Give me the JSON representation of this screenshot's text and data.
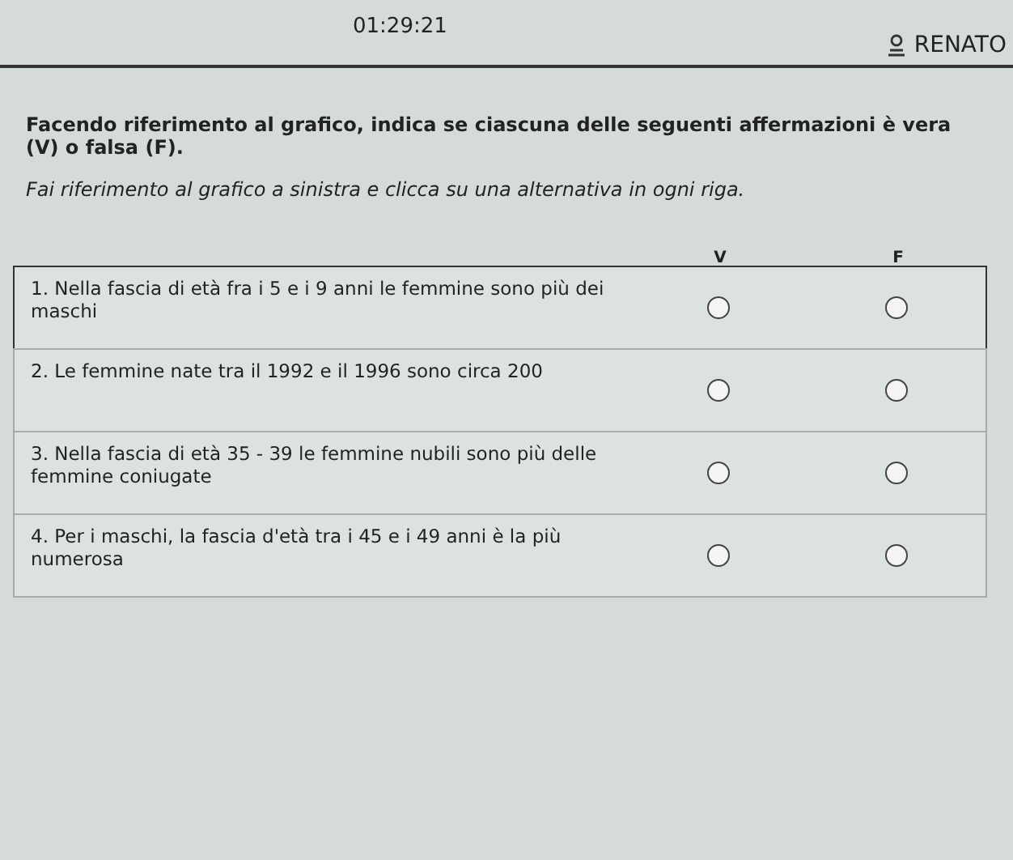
{
  "header": {
    "timer": "01:29:21",
    "user": "RENATO"
  },
  "instructions": {
    "title": "Facendo riferimento al grafico, indica se ciascuna delle seguenti affermazioni è vera (V) o falsa (F).",
    "hint": "Fai riferimento al grafico a sinistra e clicca su una alternativa in ogni riga."
  },
  "columns": [
    "V",
    "F"
  ],
  "rows": [
    {
      "text": "1. Nella fascia di età fra i 5 e i 9 anni le femmine sono più dei maschi",
      "highlighted": true,
      "options": [
        {
          "selected": false
        },
        {
          "selected": false
        }
      ]
    },
    {
      "text": "2. Le femmine nate tra il 1992 e il 1996 sono circa 200",
      "highlighted": false,
      "options": [
        {
          "selected": false
        },
        {
          "selected": false
        }
      ]
    },
    {
      "text": "3. Nella fascia di età 35 - 39 le femmine nubili sono più delle femmine coniugate",
      "highlighted": false,
      "options": [
        {
          "selected": false
        },
        {
          "selected": false
        }
      ]
    },
    {
      "text": "4. Per i maschi, la fascia d'età tra i 45 e i 49 anni è la più numerosa",
      "highlighted": false,
      "options": [
        {
          "selected": false
        },
        {
          "selected": false
        }
      ]
    }
  ]
}
